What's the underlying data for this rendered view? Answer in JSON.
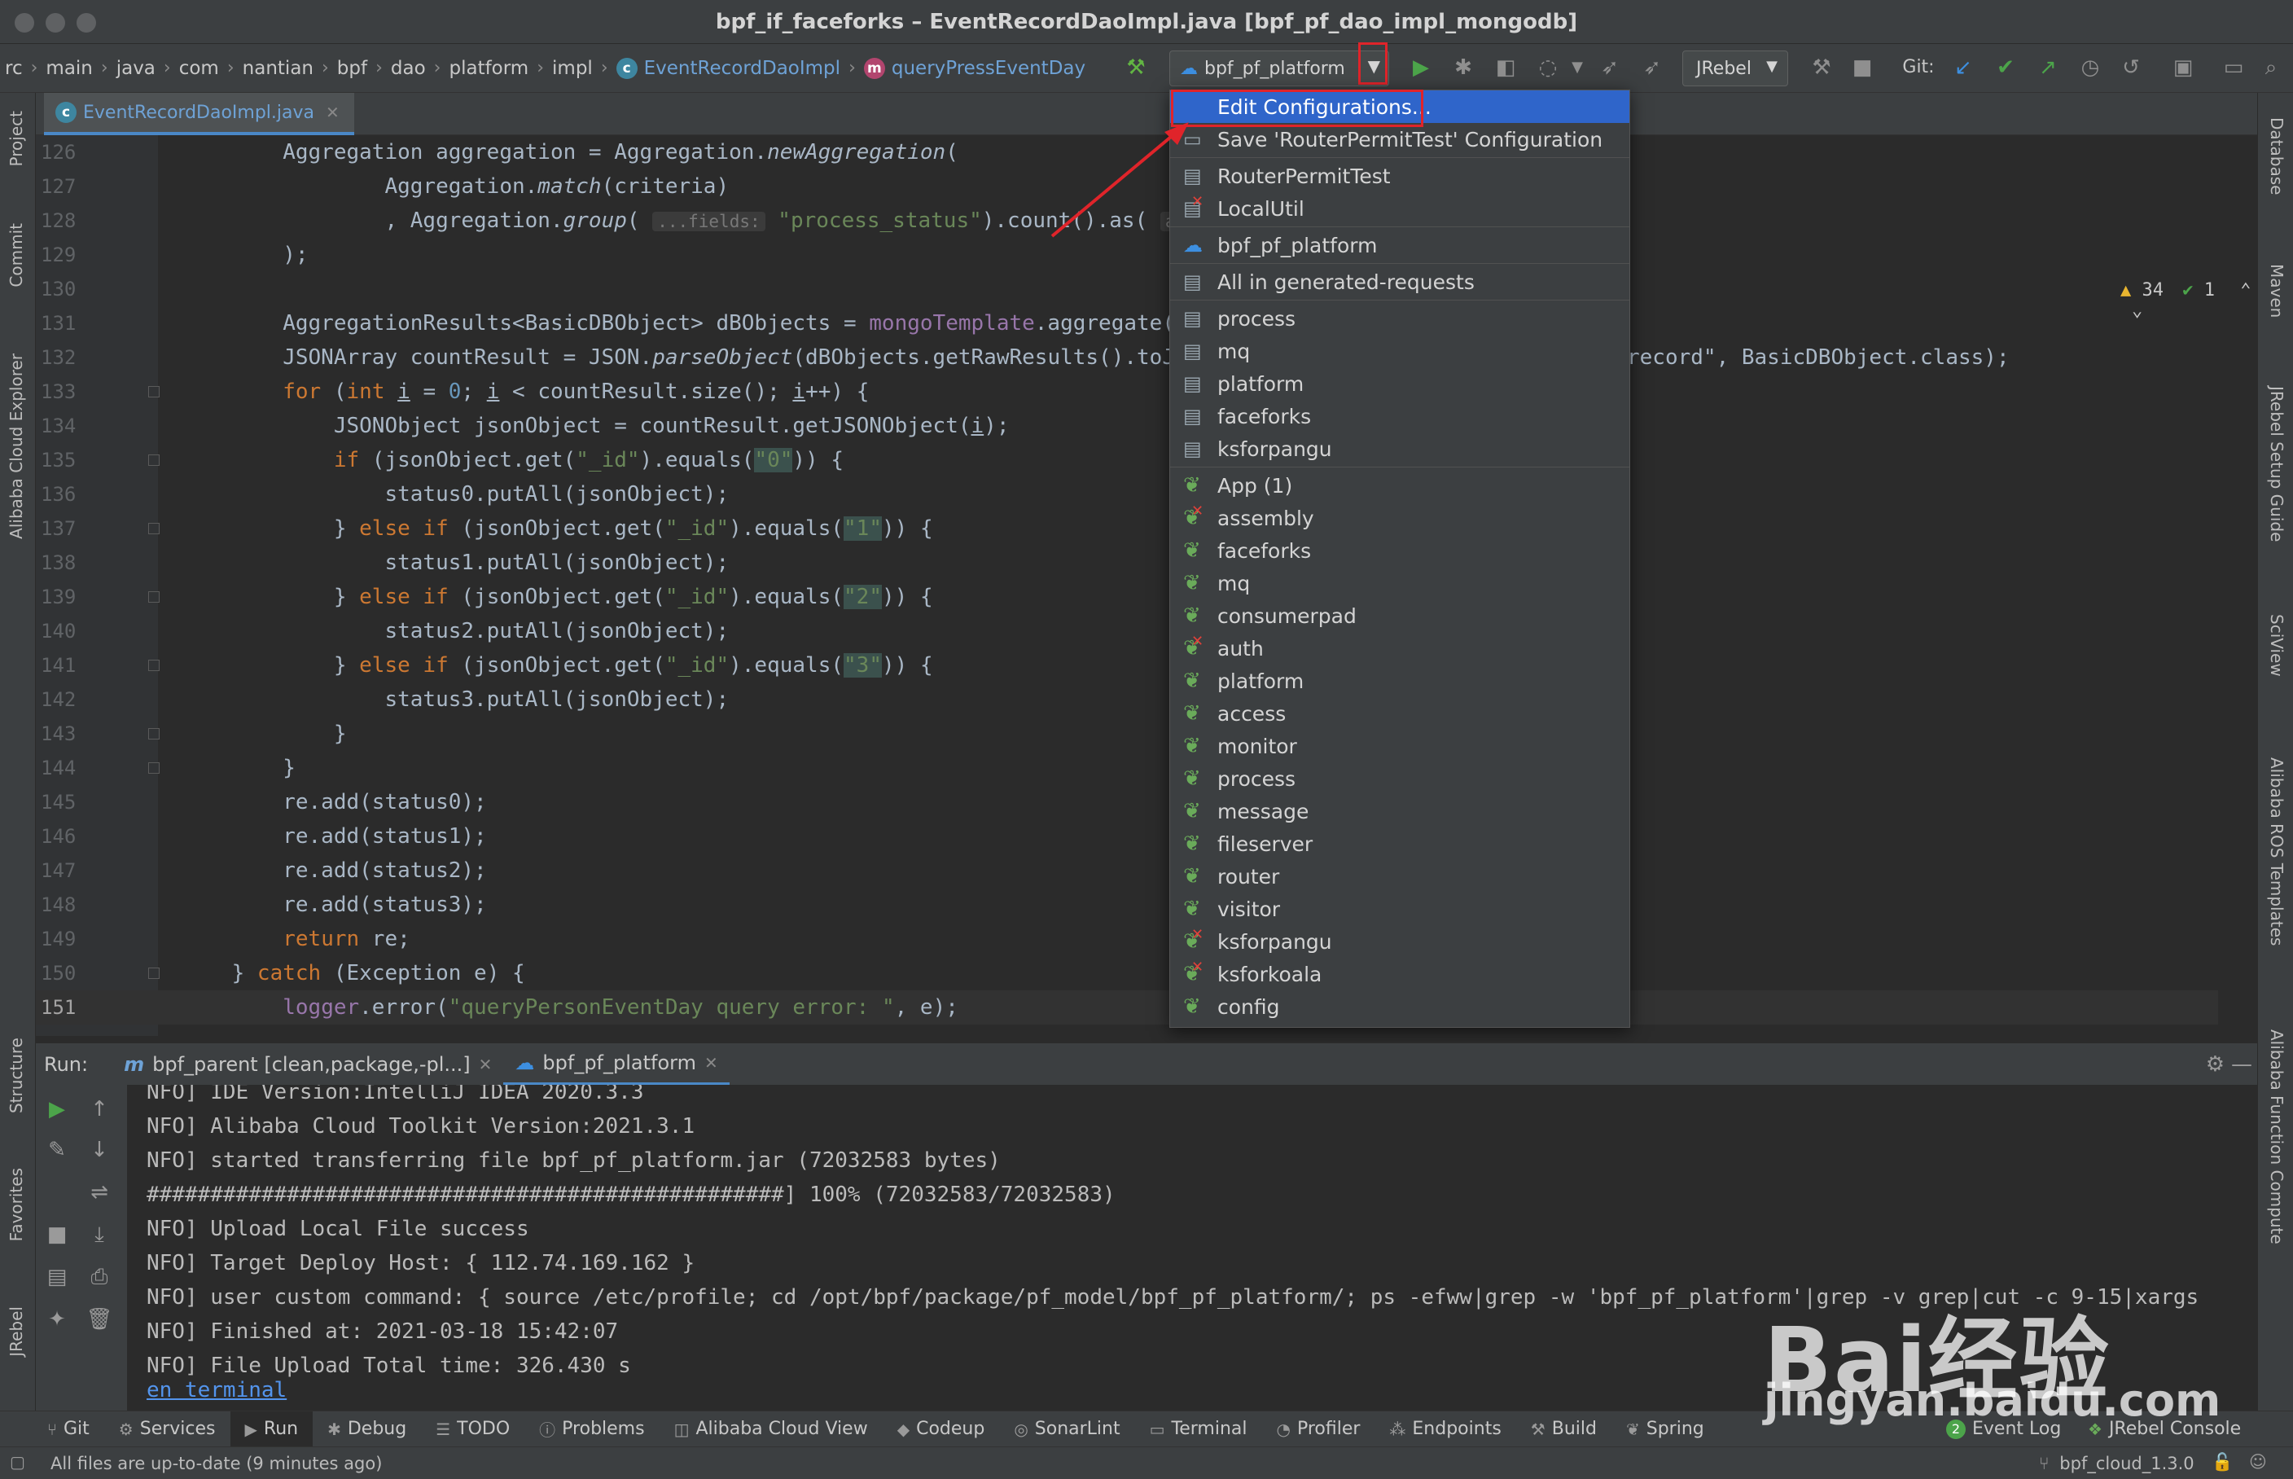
{
  "window": {
    "title": "bpf_if_faceforks – EventRecordDaoImpl.java [bpf_pf_dao_impl_mongodb]"
  },
  "breadcrumbs": [
    "rc",
    "main",
    "java",
    "com",
    "nantian",
    "bpf",
    "dao",
    "platform",
    "impl"
  ],
  "breadcrumb_class": "EventRecordDaoImpl",
  "breadcrumb_method": "queryPressEventDay",
  "toolbar": {
    "run_config": "bpf_pf_platform",
    "jrebel": "JRebel",
    "git_label": "Git:"
  },
  "tabs": [
    {
      "label": "EventRecordDaoImpl.java"
    }
  ],
  "left_tools": [
    "Project",
    "Commit",
    "Alibaba Cloud Explorer",
    "Structure",
    "Favorites",
    "JRebel"
  ],
  "right_tools": [
    "Database",
    "Maven",
    "JRebel Setup Guide",
    "SciView",
    "Alibaba ROS Templates",
    "Alibaba Function Compute"
  ],
  "inspections": {
    "warnings": "34",
    "checks": "1"
  },
  "code_lines": [
    {
      "n": "126",
      "html": "        Aggregation aggregation = Aggregation.<i class='ital'>newAggregation</i>("
    },
    {
      "n": "127",
      "html": "                Aggregation.<i class='ital'>match</i>(criteria)"
    },
    {
      "n": "128",
      "html": "                , Aggregation.<i class='ital'>group</i>( <span class='hint'>...fields:</span> <span class='str'>\"process_status\"</span>).count().as( <span class='hint'>alias:</span>"
    },
    {
      "n": "129",
      "html": "        );"
    },
    {
      "n": "130",
      "html": ""
    },
    {
      "n": "131",
      "html": "        AggregationResults&lt;BasicDBObject&gt; dBObjects = <span class='fld'>mongoTemplate</span>.aggregate("
    },
    {
      "n": "132",
      "html": "        JSONArray countResult = JSON.<i class='ital'>parseObject</i>(dBObjects.getRawResults().toJ"
    },
    {
      "n": "133",
      "html": "        <span class='kw'>for</span> (<span class='kw'>int</span> <u>i</u> = <span class='num'>0</span>; <u>i</u> &lt; countResult.size(); <u>i</u>++) {"
    },
    {
      "n": "134",
      "html": "            JSONObject jsonObject = countResult.getJSONObject(<u>i</u>);"
    },
    {
      "n": "135",
      "html": "            <span class='kw'>if</span> (jsonObject.get(<span class='str'>\"_id\"</span>).equals(<span class='str strhl'>\"0\"</span>)) {"
    },
    {
      "n": "136",
      "html": "                status0.putAll(jsonObject);"
    },
    {
      "n": "137",
      "html": "            } <span class='kw'>else if</span> (jsonObject.get(<span class='str'>\"_id\"</span>).equals(<span class='str strhl'>\"1\"</span>)) {"
    },
    {
      "n": "138",
      "html": "                status1.putAll(jsonObject);"
    },
    {
      "n": "139",
      "html": "            } <span class='kw'>else if</span> (jsonObject.get(<span class='str'>\"_id\"</span>).equals(<span class='str strhl'>\"2\"</span>)) {"
    },
    {
      "n": "140",
      "html": "                status2.putAll(jsonObject);"
    },
    {
      "n": "141",
      "html": "            } <span class='kw'>else if</span> (jsonObject.get(<span class='str'>\"_id\"</span>).equals(<span class='str strhl'>\"3\"</span>)) {"
    },
    {
      "n": "142",
      "html": "                status3.putAll(jsonObject);"
    },
    {
      "n": "143",
      "html": "            }"
    },
    {
      "n": "144",
      "html": "        }"
    },
    {
      "n": "145",
      "html": "        re.add(status0);"
    },
    {
      "n": "146",
      "html": "        re.add(status1);"
    },
    {
      "n": "147",
      "html": "        re.add(status2);"
    },
    {
      "n": "148",
      "html": "        re.add(status3);"
    },
    {
      "n": "149",
      "html": "        <span class='kw'>return</span> re;"
    },
    {
      "n": "150",
      "html": "    } <span class='kw'>catch</span> (Exception e) {"
    },
    {
      "n": "151",
      "html": "        <span class='fld'>logger</span>.error(<span class='str'>\"queryPersonEventDay query error: \"</span>, e);"
    }
  ],
  "code_right_fragment": "record\", BasicDBObject.class);",
  "popup": {
    "items": [
      {
        "label": "Edit Configurations...",
        "icon": "none",
        "selected": true
      },
      {
        "label": "Save 'RouterPermitTest' Configuration",
        "icon": "save-icon"
      },
      {
        "sep": true
      },
      {
        "label": "RouterPermitTest",
        "icon": "file-icon"
      },
      {
        "label": "LocalUtil",
        "icon": "file-icon",
        "error": true
      },
      {
        "sep": true
      },
      {
        "label": "bpf_pf_platform",
        "icon": "cloud-icon"
      },
      {
        "sep": true
      },
      {
        "label": "All in generated-requests",
        "icon": "file-icon"
      },
      {
        "sep": true
      },
      {
        "label": "process",
        "icon": "file-icon"
      },
      {
        "label": "mq",
        "icon": "file-icon"
      },
      {
        "label": "platform",
        "icon": "file-icon"
      },
      {
        "label": "faceforks",
        "icon": "file-icon"
      },
      {
        "label": "ksforpangu",
        "icon": "file-icon"
      },
      {
        "sep": true
      },
      {
        "label": "App (1)",
        "icon": "spring-icon"
      },
      {
        "label": "assembly",
        "icon": "spring-icon",
        "error": true
      },
      {
        "label": "faceforks",
        "icon": "spring-icon"
      },
      {
        "label": "mq",
        "icon": "spring-icon"
      },
      {
        "label": "consumerpad",
        "icon": "spring-icon"
      },
      {
        "label": "auth",
        "icon": "spring-icon",
        "error": true
      },
      {
        "label": "platform",
        "icon": "spring-icon"
      },
      {
        "label": "access",
        "icon": "spring-icon"
      },
      {
        "label": "monitor",
        "icon": "spring-icon"
      },
      {
        "label": "process",
        "icon": "spring-icon"
      },
      {
        "label": "message",
        "icon": "spring-icon"
      },
      {
        "label": "fileserver",
        "icon": "spring-icon"
      },
      {
        "label": "router",
        "icon": "spring-icon"
      },
      {
        "label": "visitor",
        "icon": "spring-icon"
      },
      {
        "label": "ksforpangu",
        "icon": "spring-icon",
        "error": true
      },
      {
        "label": "ksforkoala",
        "icon": "spring-icon",
        "error": true
      },
      {
        "label": "config",
        "icon": "spring-icon"
      }
    ]
  },
  "run_panel": {
    "label": "Run:",
    "tabs": [
      {
        "label": "bpf_parent [clean,package,-pl...]"
      },
      {
        "label": "bpf_pf_platform"
      }
    ],
    "console": [
      "NFO] IDE Version:IntelliJ IDEA 2020.3.3",
      "NFO] Alibaba Cloud Toolkit Version:2021.3.1",
      "NFO] started transferring file bpf_pf_platform.jar (72032583 bytes)",
      "##################################################] 100% (72032583/72032583)",
      "NFO] Upload Local File success",
      "NFO] Target Deploy Host: { 112.74.169.162 }",
      "NFO] user custom command: { source /etc/profile; cd /opt/bpf/package/pf_model/bpf_pf_platform/; ps -efww|grep -w 'bpf_pf_platform'|grep -v grep|cut -c 9-15|xargs",
      "NFO] Finished at: 2021-03-18 15:42:07",
      "NFO] File Upload Total time: 326.430 s"
    ],
    "console_link": "en terminal"
  },
  "bottom_tools": [
    {
      "label": "Git",
      "icon": "git-icon"
    },
    {
      "label": "Services",
      "icon": "services-icon"
    },
    {
      "label": "Run",
      "icon": "run-icon",
      "active": true
    },
    {
      "label": "Debug",
      "icon": "debug-icon"
    },
    {
      "label": "TODO",
      "icon": "todo-icon"
    },
    {
      "label": "Problems",
      "icon": "problems-icon"
    },
    {
      "label": "Alibaba Cloud View",
      "icon": "cloud-view-icon"
    },
    {
      "label": "Codeup",
      "icon": "codeup-icon"
    },
    {
      "label": "SonarLint",
      "icon": "sonarlint-icon"
    },
    {
      "label": "Terminal",
      "icon": "terminal-icon"
    },
    {
      "label": "Profiler",
      "icon": "profiler-icon"
    },
    {
      "label": "Endpoints",
      "icon": "endpoints-icon"
    },
    {
      "label": "Build",
      "icon": "build-icon"
    },
    {
      "label": "Spring",
      "icon": "spring-icon"
    }
  ],
  "bottom_right": {
    "event_log_count": "2",
    "event_log": "Event Log",
    "jrebel_console": "JRebel Console"
  },
  "status": {
    "message": "All files are up-to-date (9 minutes ago)",
    "branch": "bpf_cloud_1.3.0"
  },
  "watermark": {
    "brand": "Bai经验",
    "url": "jingyan.baidu.com"
  }
}
